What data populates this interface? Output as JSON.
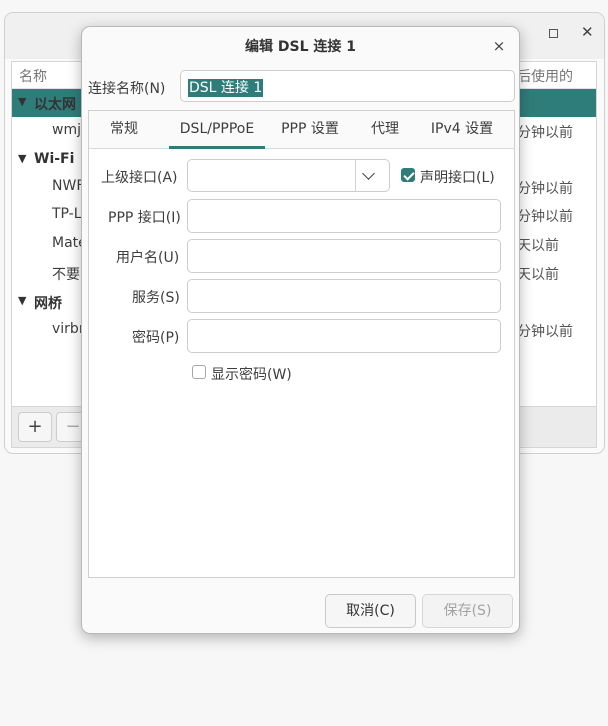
{
  "background_window": {
    "columns": {
      "name": "名称",
      "last_used": "后使用的"
    },
    "rows": [
      {
        "type": "group",
        "name": "以太网",
        "selected": true
      },
      {
        "type": "item",
        "name": "wmj",
        "last_used": "分钟以前"
      },
      {
        "type": "group",
        "name": "Wi-Fi"
      },
      {
        "type": "item",
        "name": "NWF",
        "last_used": "分钟以前"
      },
      {
        "type": "item",
        "name": "TP-L",
        "last_used": "分钟以前"
      },
      {
        "type": "item",
        "name": "Mate",
        "last_used": "天以前"
      },
      {
        "type": "item",
        "name": "不要",
        "last_used": "天以前"
      },
      {
        "type": "group",
        "name": "网桥"
      },
      {
        "type": "item",
        "name": "virbr",
        "last_used": "分钟以前"
      }
    ],
    "add_button": "+",
    "remove_button": "−"
  },
  "dialog": {
    "title": "编辑 DSL 连接 1",
    "close": "×",
    "connection_name_label": "连接名称(N)",
    "connection_name_value": "DSL 连接 1",
    "tabs": [
      {
        "label": "常规",
        "active": false
      },
      {
        "label": "DSL/PPPoE",
        "active": true
      },
      {
        "label": "PPP 设置",
        "active": false
      },
      {
        "label": "代理",
        "active": false
      },
      {
        "label": "IPv4 设置",
        "active": false
      }
    ],
    "form": {
      "parent_label": "上级接口(A)",
      "parent_value": "",
      "claim_label": "声明接口(L)",
      "claim_checked": true,
      "ppp_label": "PPP 接口(I)",
      "ppp_value": "",
      "username_label": "用户名(U)",
      "username_value": "",
      "service_label": "服务(S)",
      "service_value": "",
      "password_label": "密码(P)",
      "password_value": "",
      "show_password_label": "显示密码(W)",
      "show_password_checked": false
    },
    "cancel_label": "取消(C)",
    "save_label": "保存(S)"
  },
  "colors": {
    "accent": "#2f7d7a"
  }
}
